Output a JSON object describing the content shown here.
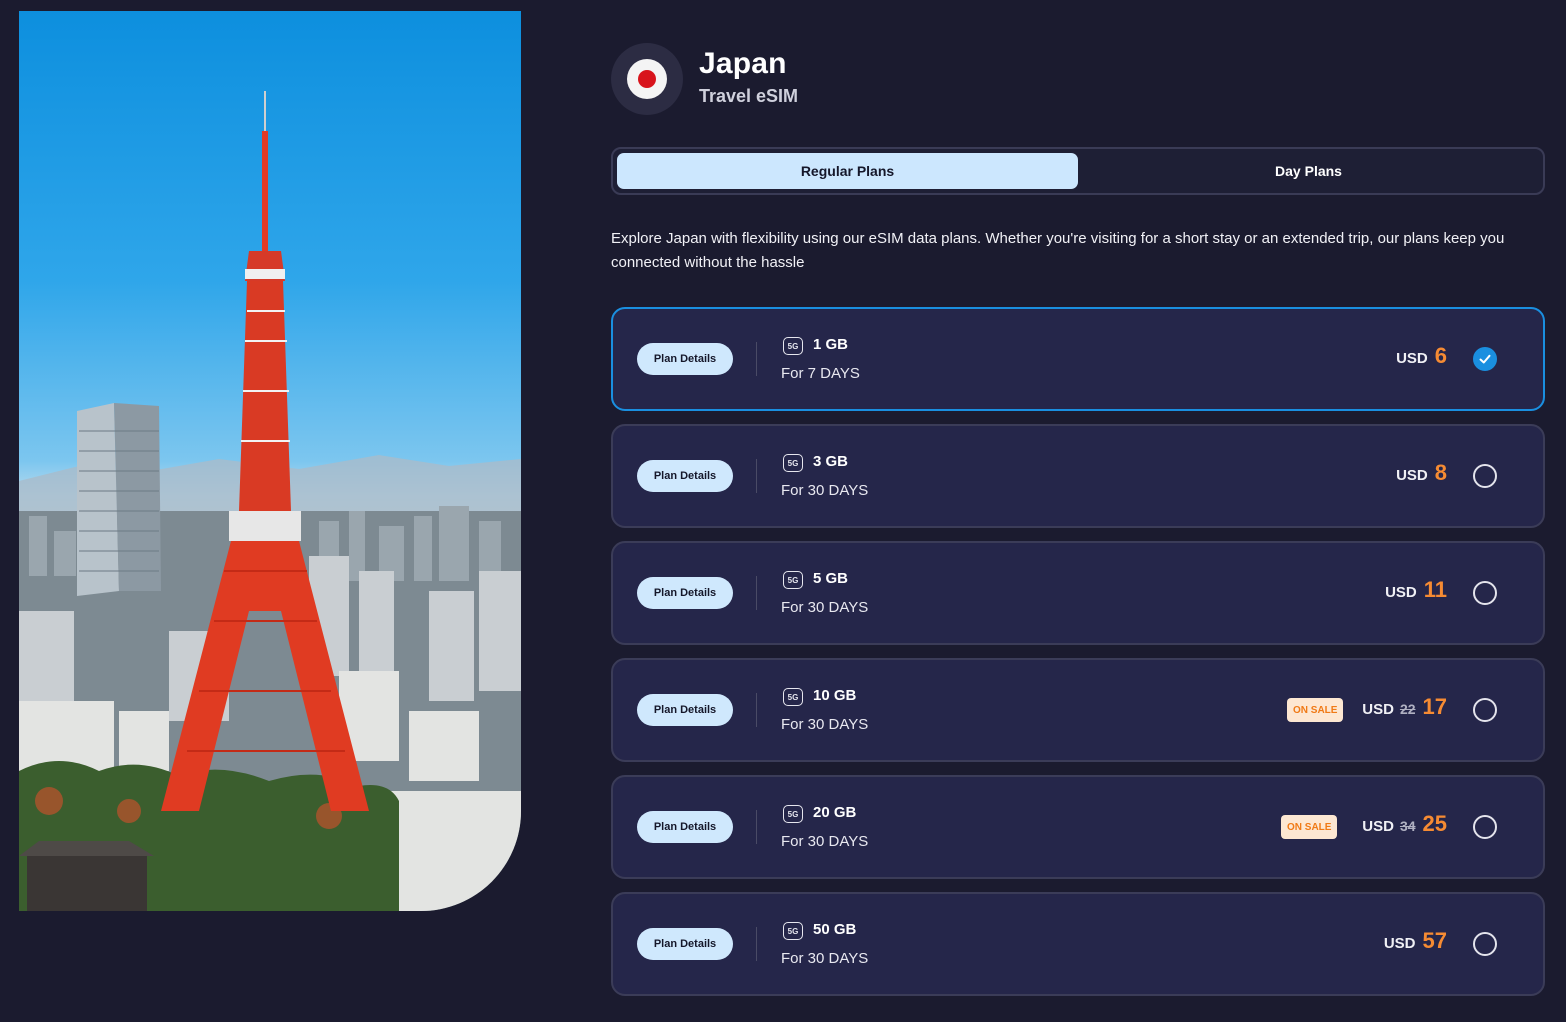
{
  "header": {
    "country": "Japan",
    "subtitle": "Travel eSIM",
    "flag_icon": "japan-flag-icon"
  },
  "tabs": [
    {
      "label": "Regular Plans",
      "active": true
    },
    {
      "label": "Day Plans",
      "active": false
    }
  ],
  "intro": "Explore Japan with flexibility using our eSIM data plans. Whether you're visiting for a short stay or an extended trip, our plans keep you connected without the hassle",
  "plans": [
    {
      "details_label": "Plan Details",
      "network": "5G",
      "data": "1 GB",
      "duration": "For 7 DAYS",
      "currency": "USD",
      "price": "6",
      "old_price": "",
      "sale": "",
      "selected": true
    },
    {
      "details_label": "Plan Details",
      "network": "5G",
      "data": "3 GB",
      "duration": "For 30 DAYS",
      "currency": "USD",
      "price": "8",
      "old_price": "",
      "sale": "",
      "selected": false
    },
    {
      "details_label": "Plan Details",
      "network": "5G",
      "data": "5 GB",
      "duration": "For 30 DAYS",
      "currency": "USD",
      "price": "11",
      "old_price": "",
      "sale": "",
      "selected": false
    },
    {
      "details_label": "Plan Details",
      "network": "5G",
      "data": "10 GB",
      "duration": "For 30 DAYS",
      "currency": "USD",
      "price": "17",
      "old_price": "22",
      "sale": "ON SALE",
      "selected": false
    },
    {
      "details_label": "Plan Details",
      "network": "5G",
      "data": "20 GB",
      "duration": "For 30 DAYS",
      "currency": "USD",
      "price": "25",
      "old_price": "34",
      "sale": "ON SALE",
      "selected": false
    },
    {
      "details_label": "Plan Details",
      "network": "5G",
      "data": "50 GB",
      "duration": "For 30 DAYS",
      "currency": "USD",
      "price": "57",
      "old_price": "",
      "sale": "",
      "selected": false
    }
  ],
  "colors": {
    "background": "#1b1b2f",
    "card": "#25264a",
    "accent_blue": "#1a8fe0",
    "price_orange": "#f68b33",
    "tab_active": "#cce7fe"
  }
}
